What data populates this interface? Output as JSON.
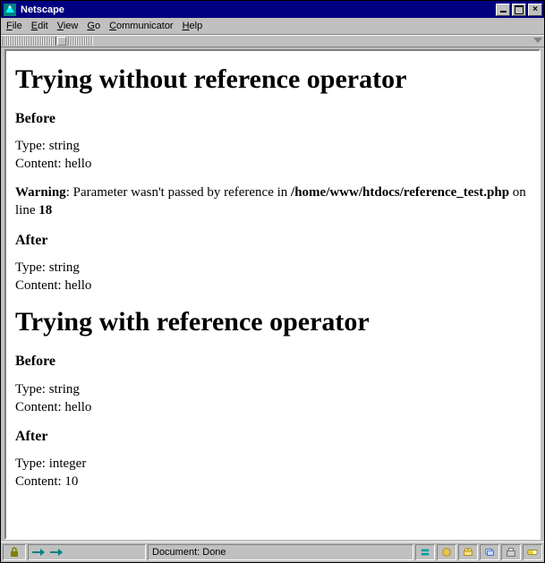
{
  "window": {
    "title": "Netscape"
  },
  "menu": {
    "file": "File",
    "edit": "Edit",
    "view": "View",
    "go": "Go",
    "communicator": "Communicator",
    "help": "Help"
  },
  "page": {
    "section1": {
      "heading": "Trying without reference operator",
      "before_label": "Before",
      "before_type": "Type: string",
      "before_content": "Content: hello",
      "warning_label": "Warning",
      "warning_mid": ": Parameter wasn't passed by reference in ",
      "warning_path": "/home/www/htdocs/reference_test.php",
      "warning_online": " on line ",
      "warning_line": "18",
      "after_label": "After",
      "after_type": "Type: string",
      "after_content": "Content: hello"
    },
    "section2": {
      "heading": "Trying with reference operator",
      "before_label": "Before",
      "before_type": "Type: string",
      "before_content": "Content: hello",
      "after_label": "After",
      "after_type": "Type: integer",
      "after_content": "Content: 10"
    }
  },
  "status": {
    "text": "Document: Done"
  }
}
